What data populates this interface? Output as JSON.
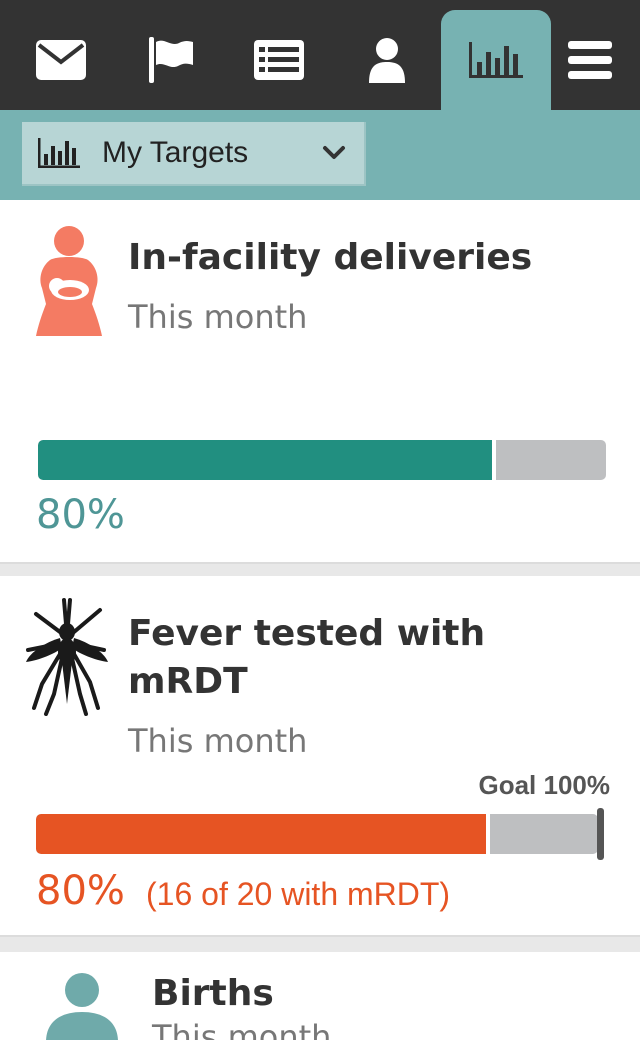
{
  "nav": {
    "items": [
      {
        "name": "messages",
        "icon": "envelope-icon"
      },
      {
        "name": "tasks",
        "icon": "flag-icon"
      },
      {
        "name": "reports",
        "icon": "list-icon"
      },
      {
        "name": "people",
        "icon": "person-icon"
      },
      {
        "name": "analytics",
        "icon": "bar-chart-icon",
        "active": true
      },
      {
        "name": "menu",
        "icon": "hamburger-icon"
      }
    ]
  },
  "targets_dropdown": {
    "label": "My Targets",
    "icon": "bar-chart-icon"
  },
  "targets": [
    {
      "icon": "mother-baby-icon",
      "title": "In-facility deliveries",
      "subtitle": "This month",
      "progress": 0.8,
      "percent_label": "80%",
      "color": "#218f80"
    },
    {
      "icon": "mosquito-icon",
      "title_line1": "Fever tested with",
      "title_line2": "mRDT",
      "subtitle": "This month",
      "goal_label": "Goal 100%",
      "progress": 0.8,
      "percent_label": "80%",
      "detail": "(16 of 20 with mRDT)",
      "color": "#e65423"
    },
    {
      "icon": "baby-icon",
      "title": "Births",
      "subtitle": "This month"
    }
  ],
  "colors": {
    "nav_bg": "#333333",
    "accent": "#77b2b2",
    "track": "#bebfc1",
    "pct_green": "#4f9696",
    "pct_orange": "#e65423"
  }
}
